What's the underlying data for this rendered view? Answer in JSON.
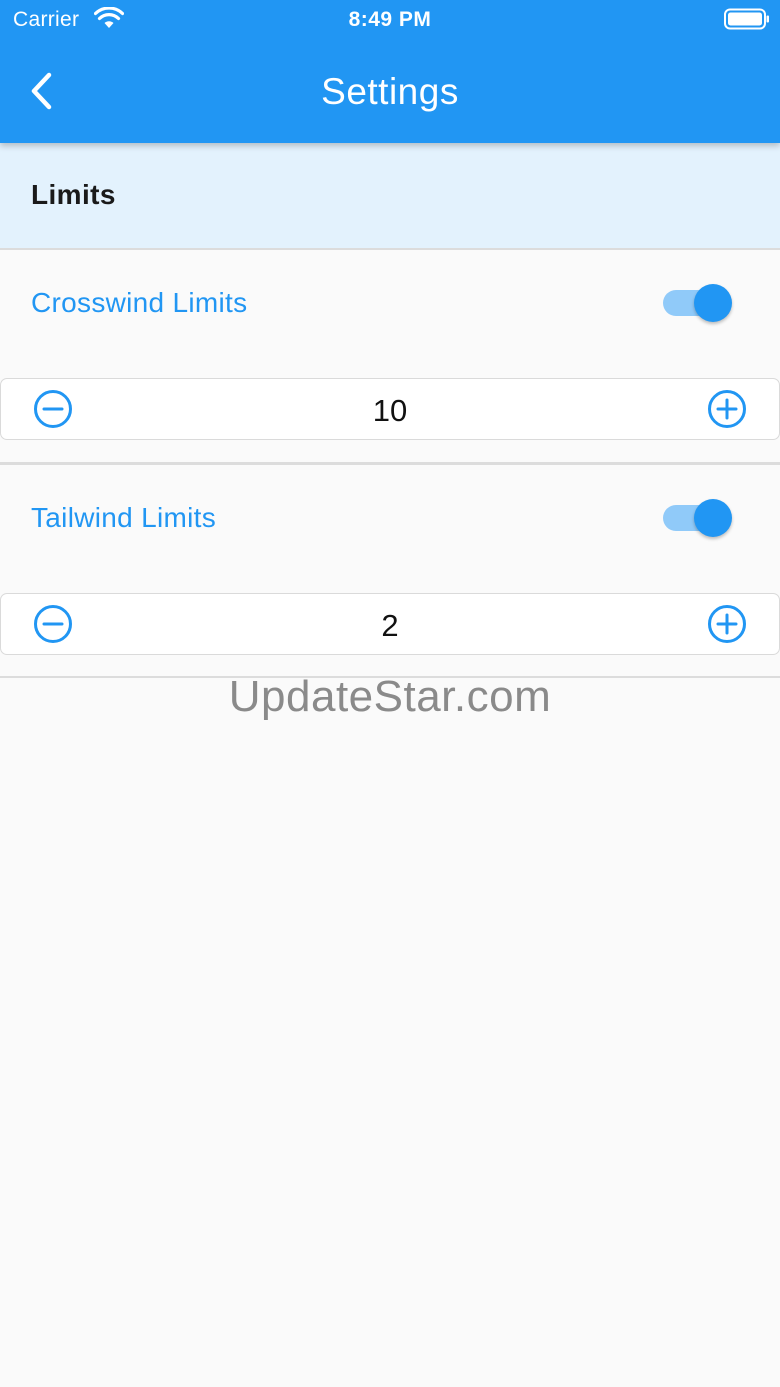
{
  "status_bar": {
    "carrier": "Carrier",
    "time": "8:49 PM",
    "wifi_icon": "wifi-icon",
    "battery_icon": "battery-icon"
  },
  "header": {
    "title": "Settings",
    "back_icon": "chevron-left-icon"
  },
  "section": {
    "title": "Limits"
  },
  "settings": [
    {
      "label": "Crosswind Limits",
      "enabled": true,
      "value": "10"
    },
    {
      "label": "Tailwind Limits",
      "enabled": true,
      "value": "2"
    }
  ],
  "watermark": "UpdateStar.com",
  "colors": {
    "primary": "#2196f3",
    "primary_light": "#90caf9",
    "section_bg": "#e3f2fd",
    "page_bg": "#fafafa"
  }
}
